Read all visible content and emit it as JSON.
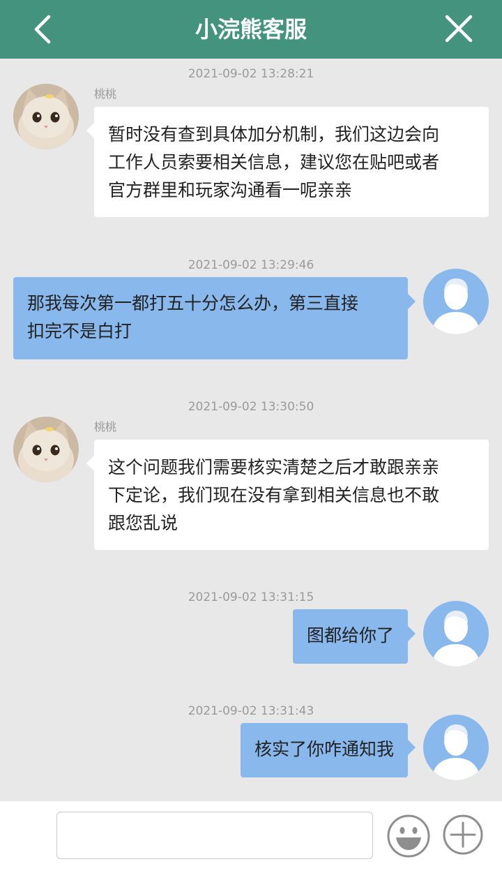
{
  "header": {
    "title": "小浣熊客服",
    "background": "#44937f"
  },
  "messages": [
    {
      "timestamp": "2021-09-02 13:28:21",
      "side": "left",
      "sender": "桃桃",
      "lines": [
        "暂时没有查到具体加分机制，我们这边会向",
        "工作人员索要相关信息，建议您在贴吧或者",
        "官方群里和玩家沟通看一呢亲亲"
      ]
    },
    {
      "timestamp": "2021-09-02 13:29:46",
      "side": "right",
      "lines": [
        "那我每次第一都打五十分怎么办，第三直接",
        "扣完不是白打"
      ]
    },
    {
      "timestamp": "2021-09-02 13:30:50",
      "side": "left",
      "sender": "桃桃",
      "lines": [
        "这个问题我们需要核实清楚之后才敢跟亲亲",
        "下定论，我们现在没有拿到相关信息也不敢",
        "跟您乱说"
      ]
    },
    {
      "timestamp": "2021-09-02 13:31:15",
      "side": "right",
      "lines": [
        "图都给你了"
      ]
    },
    {
      "timestamp": "2021-09-02 13:31:43",
      "side": "right",
      "lines": [
        "核实了你咋通知我"
      ]
    }
  ],
  "icons": {
    "back": "chevron-left-icon",
    "close": "close-icon",
    "agent_avatar": "cat-avatar",
    "user_avatar": "default-user-avatar",
    "emoji": "emoji-icon",
    "plus": "plus-icon"
  },
  "input": {
    "value": "",
    "placeholder": ""
  },
  "colors": {
    "chat_background": "#e8e8e8",
    "agent_bubble": "#ffffff",
    "user_bubble": "#89b8ec",
    "timestamp": "#9a9a9a"
  }
}
